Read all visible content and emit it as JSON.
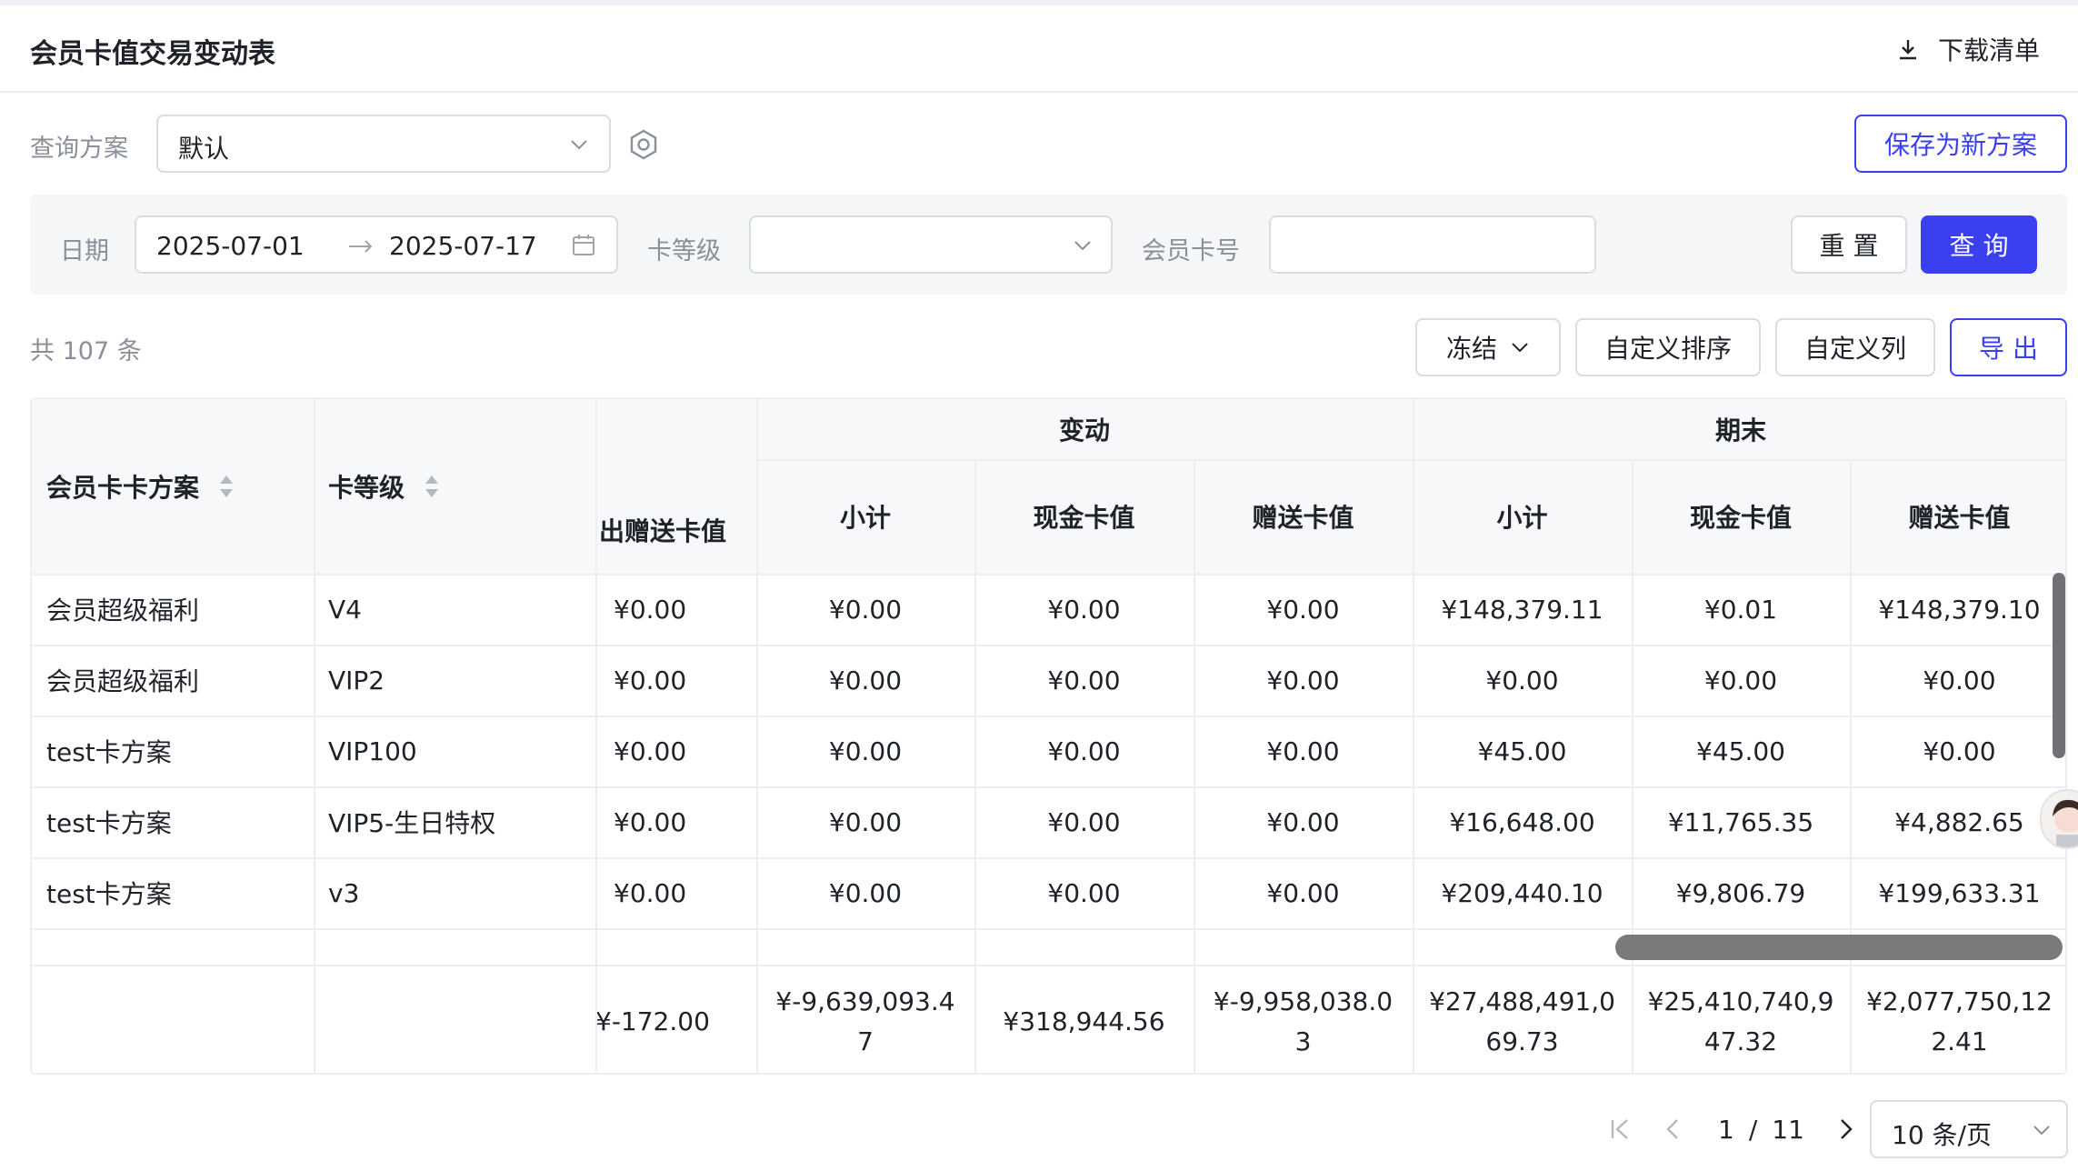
{
  "header": {
    "title": "会员卡值交易变动表",
    "download_label": "下载清单"
  },
  "scheme": {
    "label": "查询方案",
    "value": "默认",
    "save_label": "保存为新方案"
  },
  "filters": {
    "date_label": "日期",
    "date_start": "2025-07-01",
    "date_end": "2025-07-17",
    "level_label": "卡等级",
    "level_value": "",
    "card_label": "会员卡号",
    "card_value": "",
    "reset_label": "重 置",
    "query_label": "查 询"
  },
  "toolbar": {
    "total_text": "共 107 条",
    "freeze_label": "冻结",
    "custom_sort_label": "自定义排序",
    "custom_cols_label": "自定义列",
    "export_label": "导 出"
  },
  "table": {
    "groups": {
      "change": "变动",
      "end": "期末"
    },
    "headers": [
      "会员卡卡方案",
      "卡等级",
      "出赠送卡值",
      "小计",
      "现金卡值",
      "赠送卡值",
      "小计",
      "现金卡值",
      "赠送卡值"
    ],
    "rows": [
      [
        "会员超级福利",
        "V4",
        "¥0.00",
        "¥0.00",
        "¥0.00",
        "¥0.00",
        "¥148,379.11",
        "¥0.01",
        "¥148,379.10"
      ],
      [
        "会员超级福利",
        "VIP2",
        "¥0.00",
        "¥0.00",
        "¥0.00",
        "¥0.00",
        "¥0.00",
        "¥0.00",
        "¥0.00"
      ],
      [
        "test卡方案",
        "VIP100",
        "¥0.00",
        "¥0.00",
        "¥0.00",
        "¥0.00",
        "¥45.00",
        "¥45.00",
        "¥0.00"
      ],
      [
        "test卡方案",
        "VIP5-生日特权",
        "¥0.00",
        "¥0.00",
        "¥0.00",
        "¥0.00",
        "¥16,648.00",
        "¥11,765.35",
        "¥4,882.65"
      ],
      [
        "test卡方案",
        "v3",
        "¥0.00",
        "¥0.00",
        "¥0.00",
        "¥0.00",
        "¥209,440.10",
        "¥9,806.79",
        "¥199,633.31"
      ]
    ],
    "summary": [
      "",
      "",
      "¥-172.00",
      "¥-9,639,093.47",
      "¥318,944.56",
      "¥-9,958,038.03",
      "¥27,488,491,069.73",
      "¥25,410,740,947.32",
      "¥2,077,750,122.41"
    ]
  },
  "pager": {
    "current": "1",
    "separator": "/",
    "total_pages": "11",
    "page_size": "10 条/页"
  }
}
